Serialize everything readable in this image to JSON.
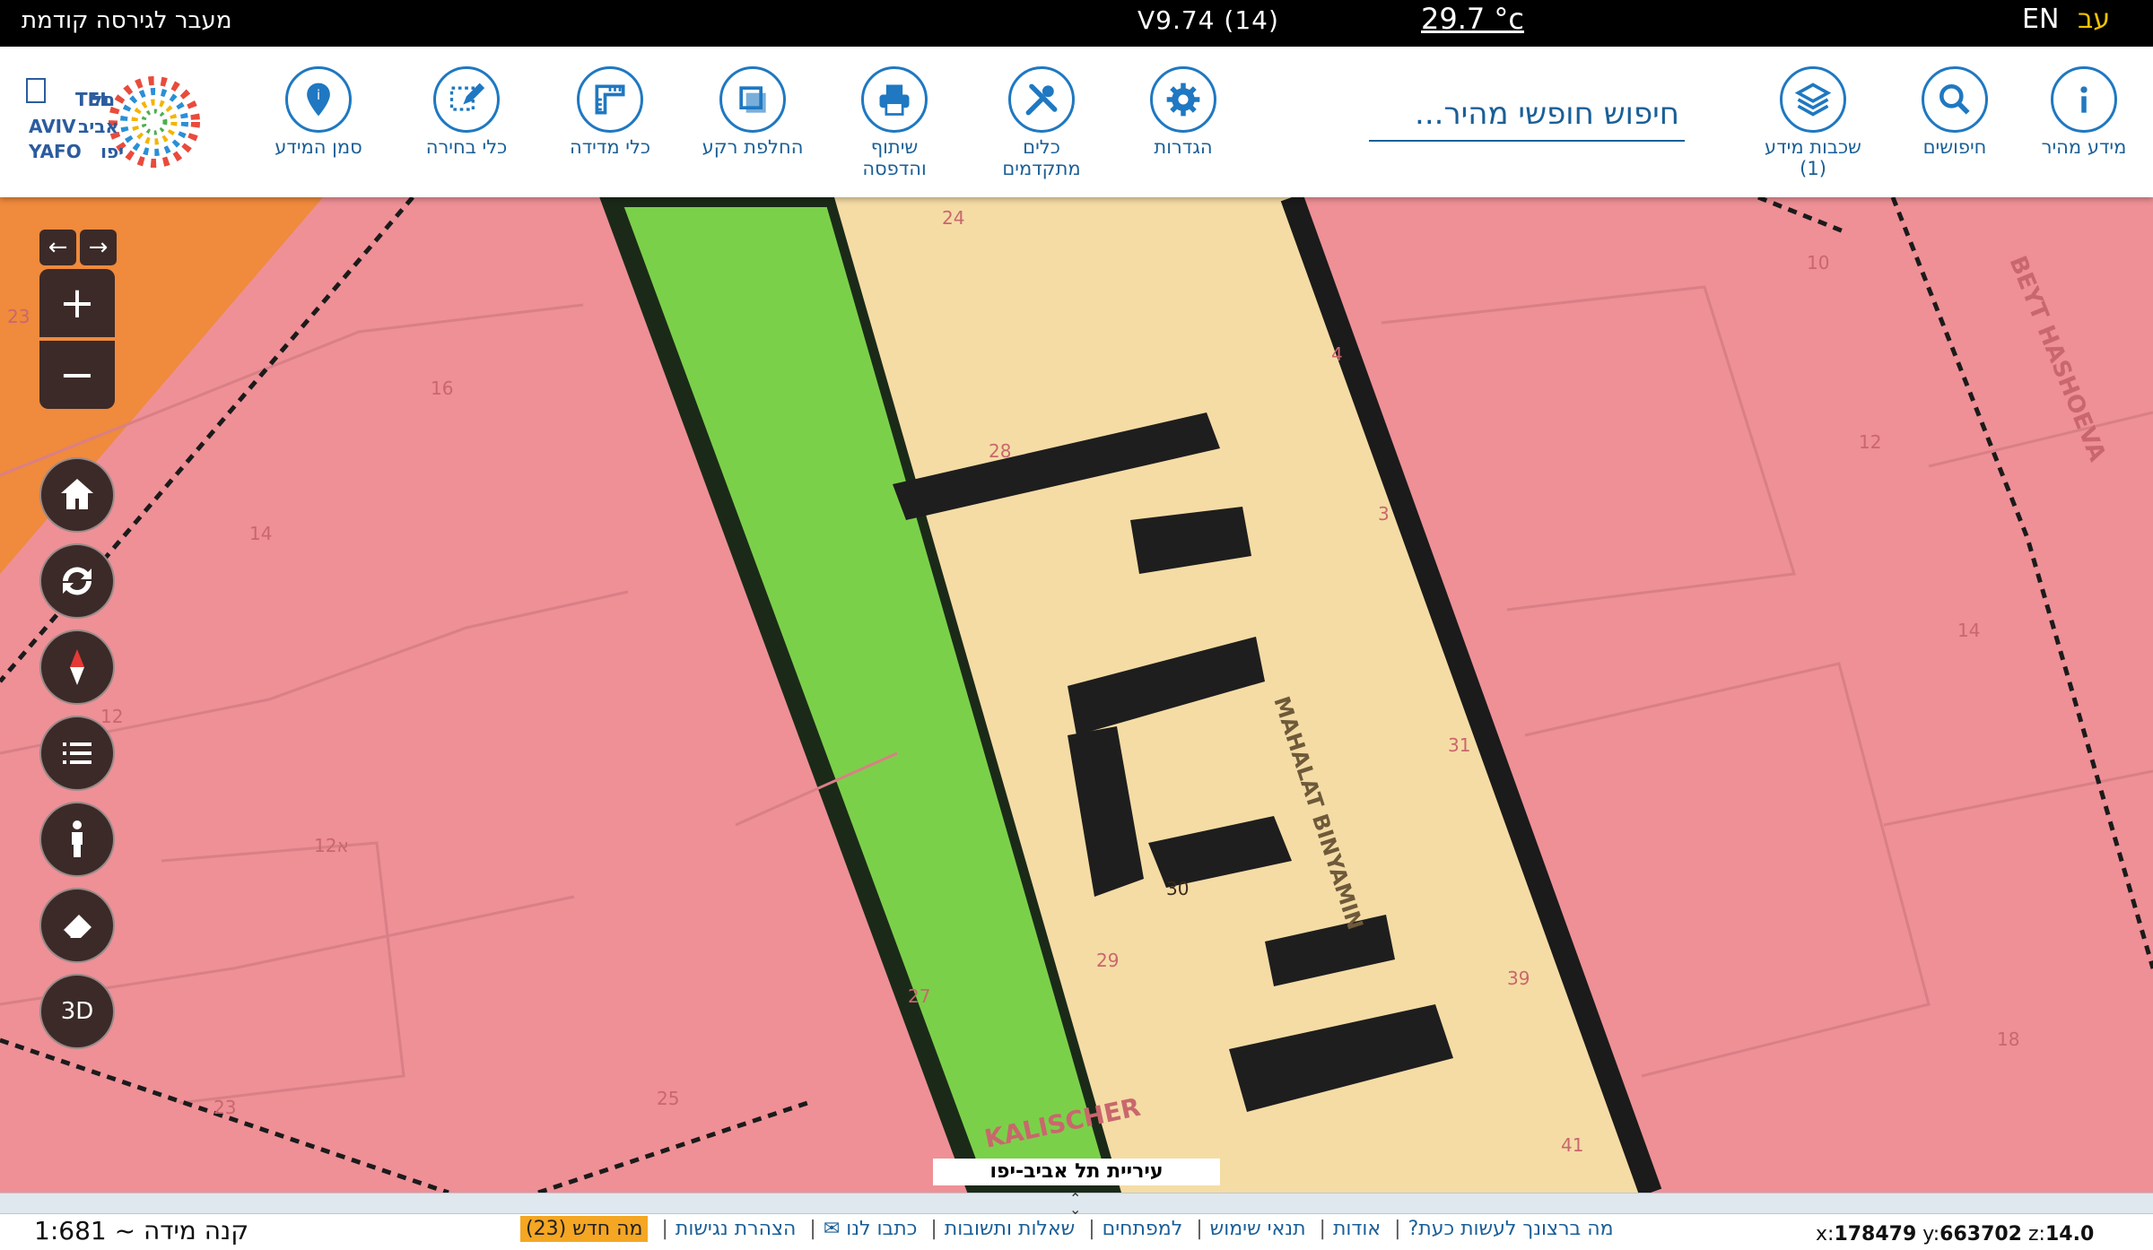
{
  "topbar": {
    "prev_version": "מעבר לגירסה קודמת",
    "version": "V9.74 (14)",
    "temperature": "29.7 °c",
    "lang_en": "EN",
    "lang_he": "עב"
  },
  "logo": {
    "text_he_top": "תל",
    "text_he_mid": "אביב",
    "text_he_bot": "יפו",
    "text_en_1": "TEL",
    "text_en_2": "AVIV",
    "text_en_3": "YAFO"
  },
  "toolbar": {
    "info_label": "סמן המידע",
    "select_label": "כלי בחירה",
    "measure_label": "כלי מדידה",
    "basemap_label": "החלפת רקע",
    "share_label_1": "שיתוף",
    "share_label_2": "והדפסה",
    "tools_label_1": "כלים",
    "tools_label_2": "מתקדמים",
    "settings_label": "הגדרות",
    "search_placeholder": "חיפוש חופשי מהיר...",
    "layers_label": "שכבות מידע",
    "layers_count": "(1)",
    "searches_label": "חיפושים",
    "quickinfo_label": "מידע מהיר"
  },
  "map": {
    "controls": {
      "three_d": "3D"
    },
    "credit": "עיריית תל אביב-יפו",
    "street_labels": [
      "KALISCHER",
      "BEYT HASHOEVA",
      "MAHALAT BINYAMIN"
    ],
    "parcel_numbers": [
      "24",
      "23",
      "16",
      "14",
      "12",
      "12א",
      "23",
      "25",
      "27",
      "28",
      "30",
      "29",
      "31",
      "39",
      "41",
      "10",
      "12",
      "14",
      "18",
      "4",
      "3"
    ]
  },
  "bottom": {
    "scale": "קנה מידה ~ 1:681",
    "links": [
      "מה ברצונך לעשות כעת?",
      "אודות",
      "תנאי שימוש",
      "למפתחים",
      "שאלות ותשובות",
      "כתבו לנו ✉",
      "הצהרת נגישות"
    ],
    "new_badge": "מה חדש (23)",
    "x_label": "x:",
    "x_value": "178479",
    "y_label": "y:",
    "y_value": "663702",
    "z_label": "z:",
    "z_value": "14.0"
  },
  "colors": {
    "accent": "#1f78c1",
    "residential": "#ee9096",
    "road": "#f5dca5",
    "park": "#7bd04a",
    "commercial": "#f08a3c",
    "control": "#3b2a28"
  }
}
